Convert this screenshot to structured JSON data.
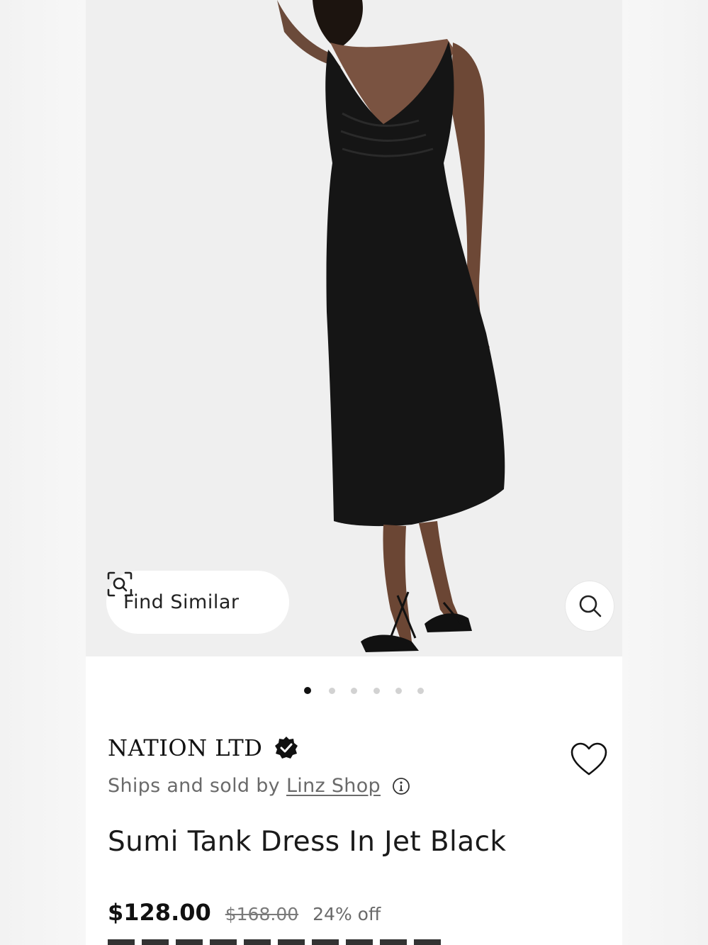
{
  "product_image": {
    "alt": "Model wearing black sleeveless midi dress",
    "find_similar_label": "Find Similar",
    "find_similar_icon": "camera-search-icon",
    "zoom_icon": "search-icon"
  },
  "carousel": {
    "total_slides": 6,
    "active_index": 0
  },
  "product": {
    "brand": "NATION LTD",
    "verified_icon": "verified-badge-icon",
    "ships_prefix": "Ships and sold by",
    "shop_name": "Linz Shop",
    "info_icon": "info-icon",
    "wishlist_icon": "heart-icon",
    "title": "Sumi Tank Dress In Jet Black",
    "price_current": "$128.00",
    "price_original": "$168.00",
    "discount": "24% off"
  },
  "colors": {
    "card_bg": "#ffffff",
    "image_bg": "#efefef",
    "text_primary": "#111111",
    "text_secondary": "#6a6a6a",
    "dot_active": "#111111",
    "dot_inactive": "#d2d2d2"
  }
}
